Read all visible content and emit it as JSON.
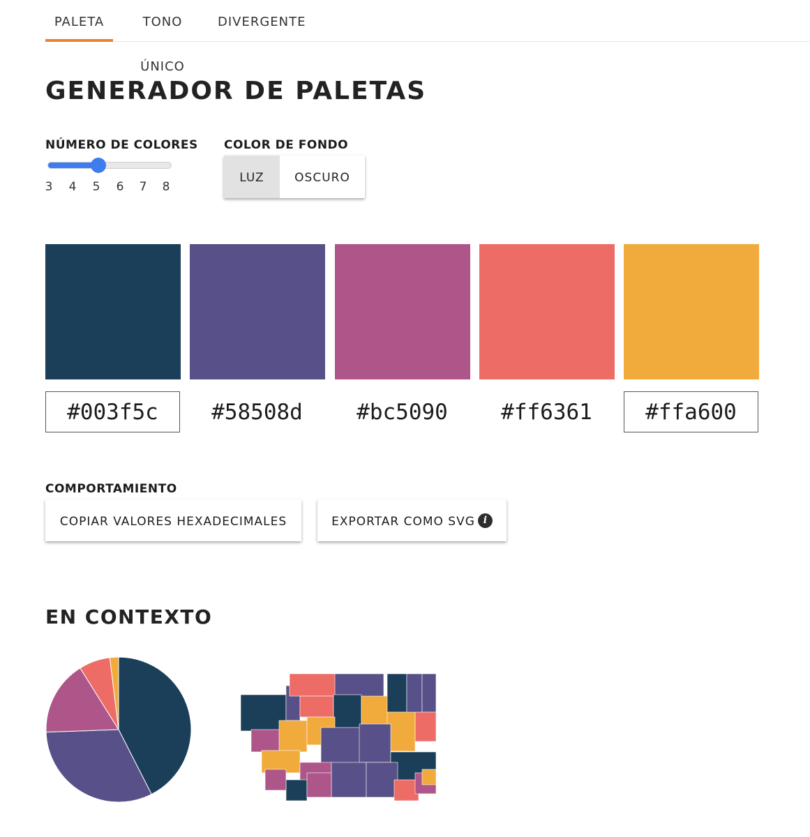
{
  "tabs": [
    {
      "label": "PALETA",
      "active": true
    },
    {
      "label": "TONO ÚNICO",
      "active": false
    },
    {
      "label": "DIVERGENTE",
      "active": false
    }
  ],
  "page_title": "GENERADOR DE PALETAS",
  "color_count": {
    "label": "NÚMERO DE COLORES",
    "value": 5,
    "min": 3,
    "max": 8,
    "ticks": [
      "3",
      "4",
      "5",
      "6",
      "7",
      "8"
    ]
  },
  "background": {
    "label": "COLOR DE FONDO",
    "options": [
      "LUZ",
      "OSCURO"
    ],
    "selected": "LUZ"
  },
  "palette": [
    {
      "hex": "#003f5c",
      "color": "#1b3e59",
      "boxed": true
    },
    {
      "hex": "#58508d",
      "color": "#585088",
      "boxed": false
    },
    {
      "hex": "#bc5090",
      "color": "#ae5689",
      "boxed": false
    },
    {
      "hex": "#ff6361",
      "color": "#ed6c66",
      "boxed": false
    },
    {
      "hex": "#ffa600",
      "color": "#f1aa3c",
      "boxed": true
    }
  ],
  "behavior": {
    "label": "COMPORTAMIENTO",
    "copy_label": "COPIAR VALORES HEXADECIMALES",
    "export_label": "EXPORTAR COMO SVG",
    "info_icon": "info-icon"
  },
  "context": {
    "title": "EN CONTEXTO"
  },
  "accent_color": "#f07f2e",
  "slider_color": "#3f7cf0"
}
